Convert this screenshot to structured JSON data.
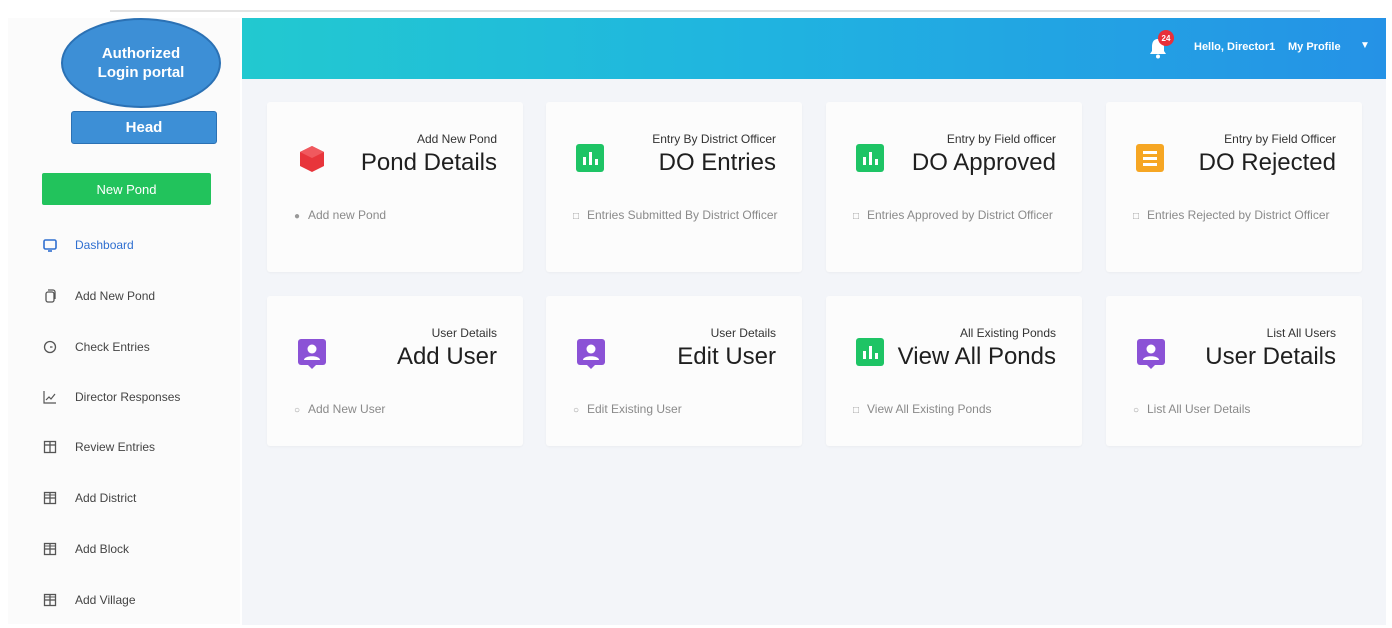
{
  "sidebar": {
    "badge_line1": "Authorized",
    "badge_line2": "Login portal",
    "head_label": "Head",
    "new_pond_label": "New Pond",
    "items": [
      {
        "label": "Dashboard",
        "icon": "monitor-icon",
        "active": true
      },
      {
        "label": "Add New Pond",
        "icon": "copy-icon"
      },
      {
        "label": "Check Entries",
        "icon": "clock-icon"
      },
      {
        "label": "Director Responses",
        "icon": "chart-line-icon"
      },
      {
        "label": "Review Entries",
        "icon": "columns-icon"
      },
      {
        "label": "Add District",
        "icon": "grid-icon"
      },
      {
        "label": "Add Block",
        "icon": "grid-icon"
      },
      {
        "label": "Add Village",
        "icon": "grid-icon"
      }
    ]
  },
  "header": {
    "notification_count": "24",
    "greeting": "Hello, Director1",
    "profile_label": "My Profile",
    "gradient_colors": [
      "#22c9d0",
      "#2592e6"
    ]
  },
  "cards": [
    {
      "sub": "Add New Pond",
      "title": "Pond Details",
      "foot": "Add new Pond",
      "icon": "cube-icon",
      "color": "#e8353b"
    },
    {
      "sub": "Entry By District Officer",
      "title": "DO Entries",
      "foot": "Entries Submitted By District Officer",
      "icon": "bar-chart-icon",
      "color": "#1ec465"
    },
    {
      "sub": "Entry by Field officer",
      "title": "DO Approved",
      "foot": "Entries Approved by District Officer",
      "icon": "bar-chart-icon",
      "color": "#1ec465"
    },
    {
      "sub": "Entry by Field Officer",
      "title": "DO Rejected",
      "foot": "Entries Rejected by District Officer",
      "icon": "list-icon",
      "color": "#f6a623"
    },
    {
      "sub": "User Details",
      "title": "Add User",
      "foot": "Add New User",
      "icon": "user-icon",
      "color": "#8b52d6"
    },
    {
      "sub": "User Details",
      "title": "Edit User",
      "foot": "Edit Existing User",
      "icon": "user-icon",
      "color": "#8b52d6"
    },
    {
      "sub": "All Existing Ponds",
      "title": "View All Ponds",
      "foot": "View All Existing Ponds",
      "icon": "bar-chart-icon",
      "color": "#1ec465"
    },
    {
      "sub": "List All Users",
      "title": "User Details",
      "foot": "List All User Details",
      "icon": "user-icon",
      "color": "#8b52d6"
    }
  ]
}
